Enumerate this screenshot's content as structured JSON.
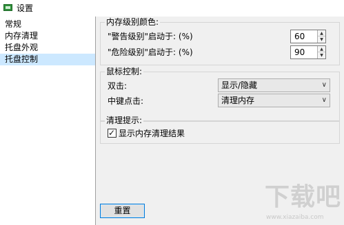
{
  "window": {
    "title": "设置",
    "icon": "app-memory-icon"
  },
  "sidebar": {
    "items": [
      {
        "label": "常规",
        "selected": false
      },
      {
        "label": "内存清理",
        "selected": false
      },
      {
        "label": "托盘外观",
        "selected": false
      },
      {
        "label": "托盘控制",
        "selected": true
      }
    ]
  },
  "memory_color_group": {
    "title": "内存级别颜色:",
    "warning_label": "\"警告级别\"启动于: (%)",
    "warning_value": "60",
    "danger_label": "\"危险级别\"启动于: (%)",
    "danger_value": "90"
  },
  "mouse_group": {
    "title": "鼠标控制:",
    "double_click_label": "双击:",
    "double_click_value": "显示/隐藏",
    "middle_click_label": "中键点击:",
    "middle_click_value": "清理内存"
  },
  "clean_tip_group": {
    "title": "清理提示:",
    "show_result_label": "显示内存清理结果",
    "show_result_checked": true
  },
  "footer": {
    "reset_label": "重置"
  },
  "watermark": {
    "big_text": "下载吧",
    "small_text": "www.xiazaiba.com"
  },
  "colors": {
    "sidebar_selected": "#cce8ff",
    "panel_bg": "#f0f0f0",
    "button_border": "#0078d7"
  }
}
